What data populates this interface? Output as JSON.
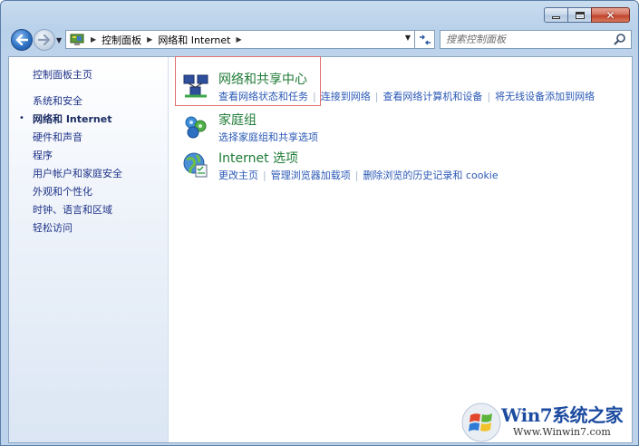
{
  "window": {
    "address_crumbs": [
      "控制面板",
      "网络和 Internet"
    ],
    "search_placeholder": "搜索控制面板"
  },
  "sidebar": {
    "items": [
      {
        "label": "控制面板主页",
        "current": false
      },
      {
        "label": "系统和安全",
        "current": false
      },
      {
        "label": "网络和 Internet",
        "current": true
      },
      {
        "label": "硬件和声音",
        "current": false
      },
      {
        "label": "程序",
        "current": false
      },
      {
        "label": "用户帐户和家庭安全",
        "current": false
      },
      {
        "label": "外观和个性化",
        "current": false
      },
      {
        "label": "时钟、语言和区域",
        "current": false
      },
      {
        "label": "轻松访问",
        "current": false
      }
    ]
  },
  "categories": [
    {
      "title": "网络和共享中心",
      "icon": "network-center-icon",
      "links": [
        "查看网络状态和任务",
        "连接到网络",
        "查看网络计算机和设备",
        "将无线设备添加到网络"
      ]
    },
    {
      "title": "家庭组",
      "icon": "homegroup-icon",
      "links": [
        "选择家庭组和共享选项"
      ]
    },
    {
      "title": "Internet 选项",
      "icon": "internet-options-icon",
      "links": [
        "更改主页",
        "管理浏览器加载项",
        "删除浏览的历史记录和 cookie"
      ]
    }
  ],
  "watermark": {
    "title": "Win7系统之家",
    "url": "Www.Winwin7.com"
  },
  "colors": {
    "accent_link": "#2a58b5",
    "category_title": "#1e7a36",
    "highlight_border": "#e07070"
  }
}
